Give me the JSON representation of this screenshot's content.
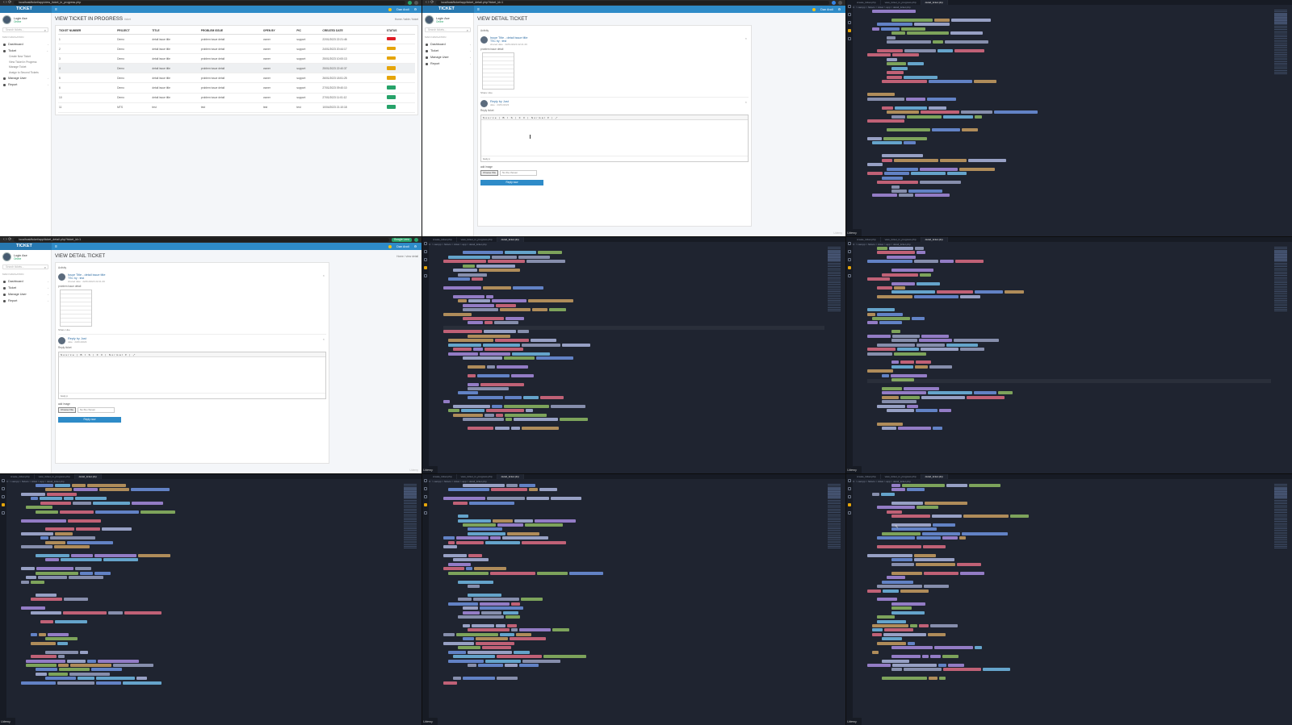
{
  "browser": {
    "url_progress": "localhost/ticket/app/view_ticket_in_progress.php",
    "url_detail": "localhost/ticket/app/ticket_detail.php?ticket_id=1",
    "url_detail_2": "localhost/ticket/app/ticket_detail.php?ticket_id=1",
    "google_lens": "Google Lens"
  },
  "app": {
    "brand": "TICKET",
    "user_name": "Login Ase",
    "user_status": "Online",
    "topbar_user": "Dan Andi",
    "search_placeholder": "Search tickets...",
    "sidebar_header": "MAIN NAVIGATION",
    "sidebar": {
      "dashboard": "Dashboard",
      "ticket": "Ticket",
      "create": "Create New Ticket",
      "in_progress": "View Ticket In Progress",
      "manage": "Manage Ticket",
      "assign": "Assign to Second Tickets",
      "user": "Manage User",
      "report": "Report"
    }
  },
  "progress_view": {
    "title": "VIEW TICKET IN PROGRESS",
    "subtitle": "ticket",
    "crumbs": "Home  /  table  /  ticket",
    "columns": [
      "TICKET NUMBER",
      "PROJECT",
      "TITLE",
      "PROBLEM ISSUE",
      "OPEN BY",
      "PIC",
      "CREATED DATE",
      "STATUS"
    ],
    "rows": [
      {
        "n": "1",
        "p": "Demo",
        "t": "detail issue title",
        "i": "problem issue detail",
        "o": "owner",
        "pic": "support",
        "d": "22/01/2023 22:21:46",
        "c": "#e01b24"
      },
      {
        "n": "2",
        "p": "Demo",
        "t": "detail issue title",
        "i": "problem issue detail",
        "o": "owner",
        "pic": "support",
        "d": "24/01/2023 20:44:17",
        "c": "#e5a50a"
      },
      {
        "n": "3",
        "p": "Demo",
        "t": "detail issue title",
        "i": "problem issue detail",
        "o": "owner",
        "pic": "support",
        "d": "25/01/2023 10:00:13",
        "c": "#e5a50a"
      },
      {
        "n": "4",
        "p": "Demo",
        "t": "detail issue title",
        "i": "problem issue detail",
        "o": "owner",
        "pic": "support",
        "d": "25/01/2023 22:40:37",
        "c": "#e5a50a"
      },
      {
        "n": "5",
        "p": "Demo",
        "t": "detail issue title",
        "i": "problem issue detail",
        "o": "owner",
        "pic": "support",
        "d": "26/01/2023 18:51:25",
        "c": "#e5a50a"
      },
      {
        "n": "6",
        "p": "Demo",
        "t": "detail issue title",
        "i": "problem issue detail",
        "o": "owner",
        "pic": "support",
        "d": "27/01/2023 09:40:10",
        "c": "#26a269"
      },
      {
        "n": "10",
        "p": "Demo",
        "t": "detail issue title",
        "i": "problem issue detail",
        "o": "owner",
        "pic": "support",
        "d": "27/01/2023 11:01:12",
        "c": "#26a269"
      },
      {
        "n": "11",
        "p": "MTS",
        "t": "test",
        "i": "test",
        "o": "test",
        "pic": "test",
        "d": "10/04/2023 21:10:18",
        "c": "#26a269"
      }
    ]
  },
  "detail_view": {
    "title": "VIEW DETAIL TICKET",
    "crumbs": "Home  /  view detail",
    "activity": "Activity",
    "post_title": "Issue Title - detail issue title",
    "post_sub": "TSC by : test",
    "post_time": "shared date : 22/01/2023 22:21:46",
    "problem_label": "problem issue detail",
    "actions": "Share    Like",
    "reply_name": "Reply by Just",
    "reply_time": "date : 23/01/2023",
    "reply_label": "Reply ticket",
    "toolbar": "Source  | B I S | ≡ ≡ | Normal  ▾ | ⤢",
    "body_label": "body  p",
    "add_image": "add image",
    "choose_file": "Choose File",
    "no_file": "No file chosen",
    "reply_button": "Reply now",
    "watermark": "Udemy"
  },
  "ide": {
    "tabs": [
      "create_ticket.php",
      "view_ticket_in_progress.php",
      "detail_ticket.php"
    ],
    "path": "C: > xampp > htdocs > ticket > app > detail_ticket.php",
    "watermark": "Udemy"
  }
}
